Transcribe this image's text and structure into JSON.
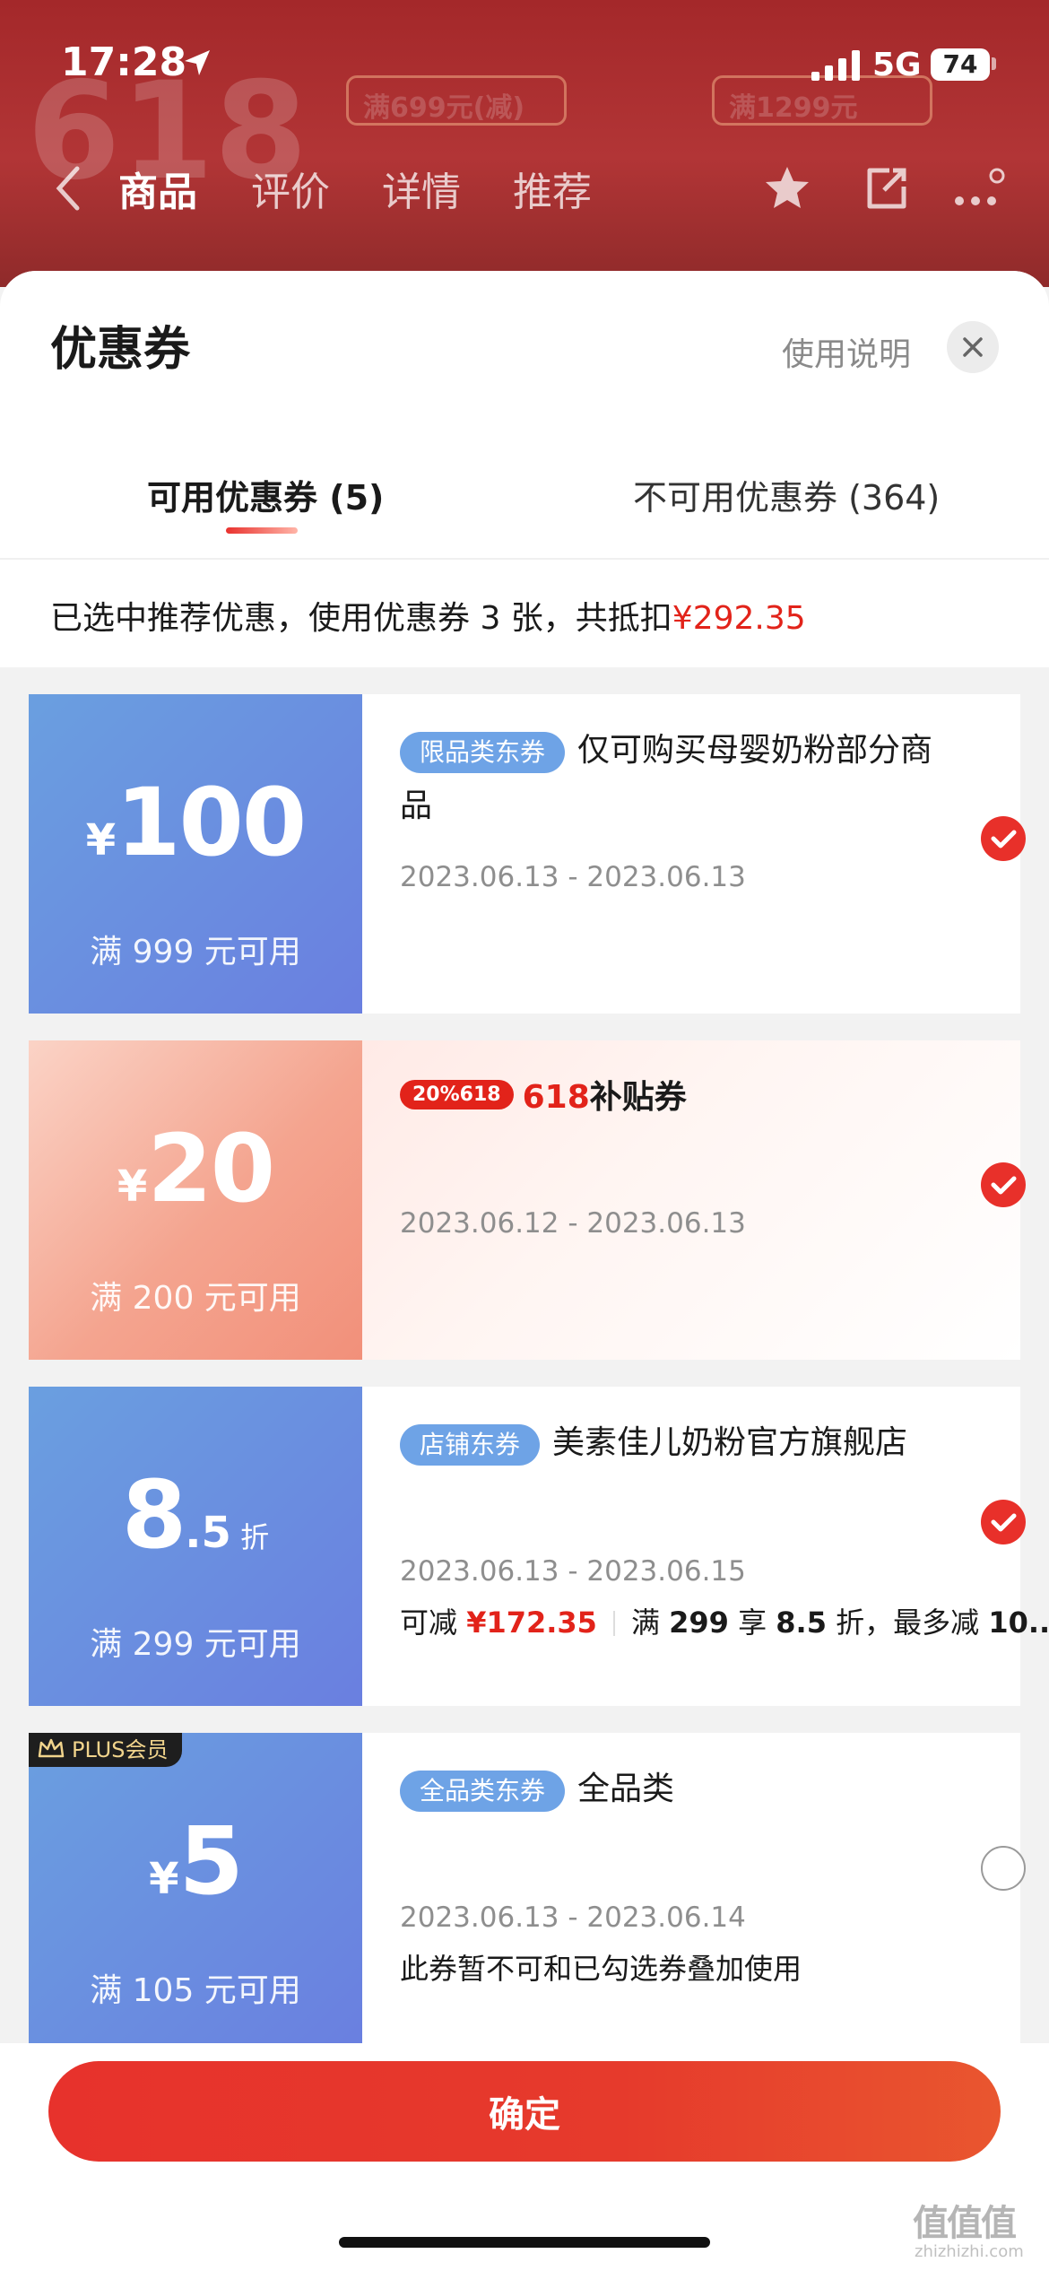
{
  "status": {
    "time": "17:28",
    "network": "5G",
    "battery": "74"
  },
  "nav": {
    "tabs": [
      "商品",
      "评价",
      "详情",
      "推荐"
    ]
  },
  "background": {
    "promo_big": "618",
    "banner1": "满699元(减)",
    "banner2": "满1299元"
  },
  "sheet": {
    "title": "优惠券",
    "help_label": "使用说明",
    "tabs": {
      "available": "可用优惠券 (5)",
      "unavailable": "不可用优惠券 (364)"
    },
    "summary_prefix": "已选中推荐优惠，使用优惠券 3 张，共抵扣",
    "summary_amount": "¥292.35"
  },
  "coupons": [
    {
      "currency": "¥",
      "value": "100",
      "condition": "满 999 元可用",
      "tag": "限品类东券",
      "title": "仅可购买母婴奶粉部分商品",
      "date": "2023.06.13 - 2023.06.13",
      "selected": true
    },
    {
      "currency": "¥",
      "value": "20",
      "condition": "满 200 元可用",
      "badge_pill": "20%618",
      "badge_text_red": "618",
      "badge_text": "补贴券",
      "date": "2023.06.12 - 2023.06.13",
      "selected": true
    },
    {
      "value_int": "8",
      "value_dec": ".5",
      "unit": "折",
      "condition": "满 299 元可用",
      "tag": "店铺东券",
      "title": "美素佳儿奶粉官方旗舰店",
      "date": "2023.06.13 - 2023.06.15",
      "save_prefix": "可减",
      "save_amount": "¥172.35",
      "rule_a": "满",
      "rule_b": "299",
      "rule_c": "享",
      "rule_d": "8.5",
      "rule_e": "折，最多减",
      "rule_f": "10...",
      "selected": true
    },
    {
      "plus_label": "PLUS会员",
      "currency": "¥",
      "value": "5",
      "condition": "满 105 元可用",
      "tag": "全品类东券",
      "title": "全品类",
      "date": "2023.06.13 - 2023.06.14",
      "note": "此券暂不可和已勾选券叠加使用",
      "selected": false
    }
  ],
  "confirm_label": "确定",
  "watermark": {
    "glyphs": "值值值",
    "domain": "zhizhizhi.com"
  },
  "colors": {
    "accent": "#e2231a",
    "coupon_blue": "#6a8fe0",
    "tag_blue": "#6ea3e6",
    "plus_gold": "#f1d48c"
  }
}
